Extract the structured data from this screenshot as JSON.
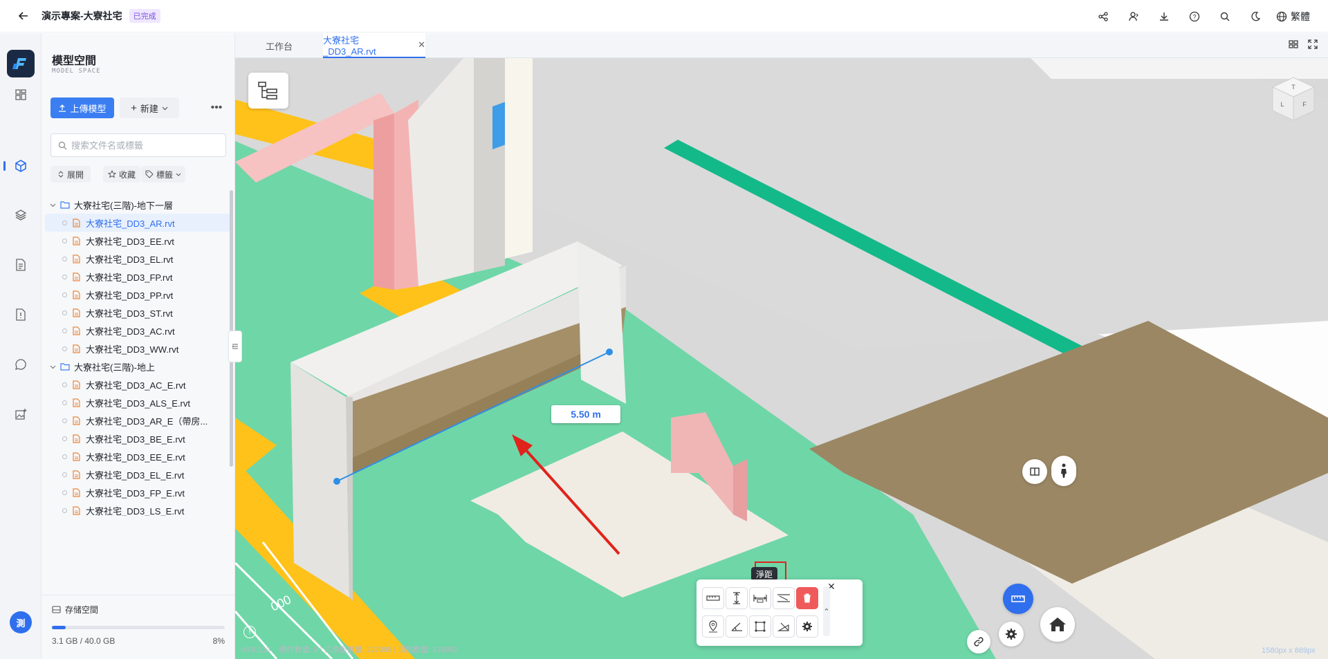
{
  "header": {
    "project_title": "演示專案-大寮社宅",
    "status_badge": "已完成",
    "language": "繁體"
  },
  "rail": {
    "avatar_text": "測"
  },
  "panel": {
    "title": "模型空間",
    "subtitle": "MODEL SPACE",
    "upload_label": "上傳模型",
    "new_label": "新建",
    "search_placeholder": "搜索文件名或標籤",
    "filters": {
      "expand": "展開",
      "favorite": "收藏",
      "tags": "標籤"
    },
    "groups": [
      {
        "name": "大寮社宅(三階)-地下一層",
        "files": [
          "大寮社宅_DD3_AR.rvt",
          "大寮社宅_DD3_EE.rvt",
          "大寮社宅_DD3_EL.rvt",
          "大寮社宅_DD3_FP.rvt",
          "大寮社宅_DD3_PP.rvt",
          "大寮社宅_DD3_ST.rvt",
          "大寮社宅_DD3_AC.rvt",
          "大寮社宅_DD3_WW.rvt"
        ]
      },
      {
        "name": "大寮社宅(三階)-地上",
        "files": [
          "大寮社宅_DD3_AC_E.rvt",
          "大寮社宅_DD3_ALS_E.rvt",
          "大寮社宅_DD3_AR_E（帶房...",
          "大寮社宅_DD3_BE_E.rvt",
          "大寮社宅_DD3_EE_E.rvt",
          "大寮社宅_DD3_EL_E.rvt",
          "大寮社宅_DD3_FP_E.rvt",
          "大寮社宅_DD3_LS_E.rvt"
        ]
      }
    ],
    "storage": {
      "label": "存储空間",
      "used": "3.1 GB / 40.0 GB",
      "percent_text": "8%",
      "percent": 8
    }
  },
  "tabs": [
    {
      "label": "工作台"
    },
    {
      "label": "大寮社宅_DD3_AR.rvt"
    }
  ],
  "viewport": {
    "dimension_label": "5.50 m",
    "tooltip": "淨距",
    "status_version": "v3.9.213",
    "status_text": "構件數量: 0 | 三角面數量: 227095 | 頂點數量: 126052",
    "resolution": "1580px x 869px"
  },
  "colors": {
    "accent": "#2f6fed",
    "floor_green": "#6fd6a8",
    "floor_brown": "#9b8764",
    "wall_pink": "#f4b3b3",
    "stripe_yellow": "#ffc21a",
    "annotation_red": "#e0231b"
  }
}
